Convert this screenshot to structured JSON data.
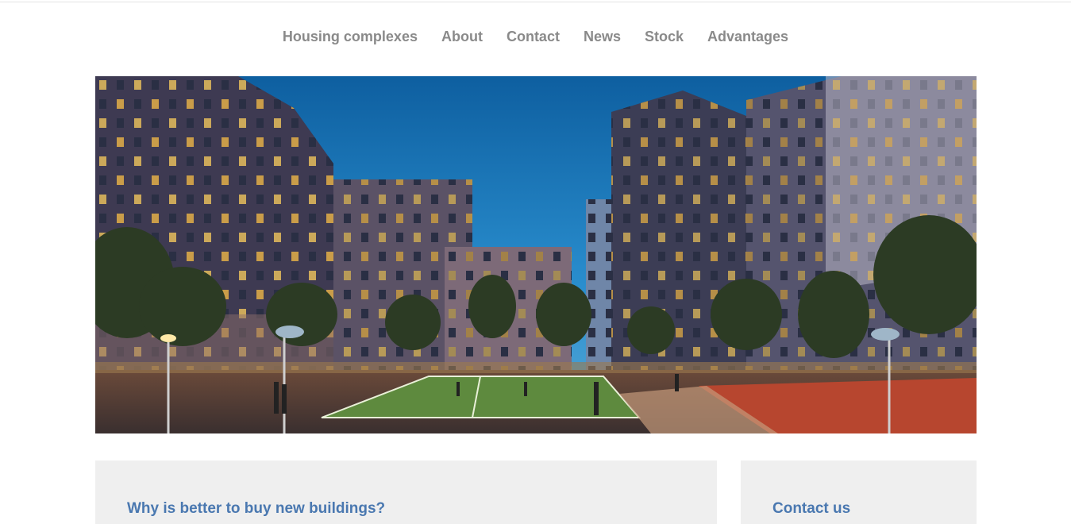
{
  "nav": {
    "items": [
      {
        "label": "Housing complexes"
      },
      {
        "label": "About"
      },
      {
        "label": "Contact"
      },
      {
        "label": "News"
      },
      {
        "label": "Stock"
      },
      {
        "label": "Advantages"
      }
    ]
  },
  "hero": {
    "icon": "residential-complex-night-photo"
  },
  "main_card": {
    "title": "Why is better to buy new buildings?"
  },
  "side_card": {
    "title": "Contact us"
  },
  "colors": {
    "nav_text": "#8a8a8a",
    "card_bg": "#efefef",
    "card_title": "#4a78b0",
    "sky": "#1f7fc0"
  }
}
